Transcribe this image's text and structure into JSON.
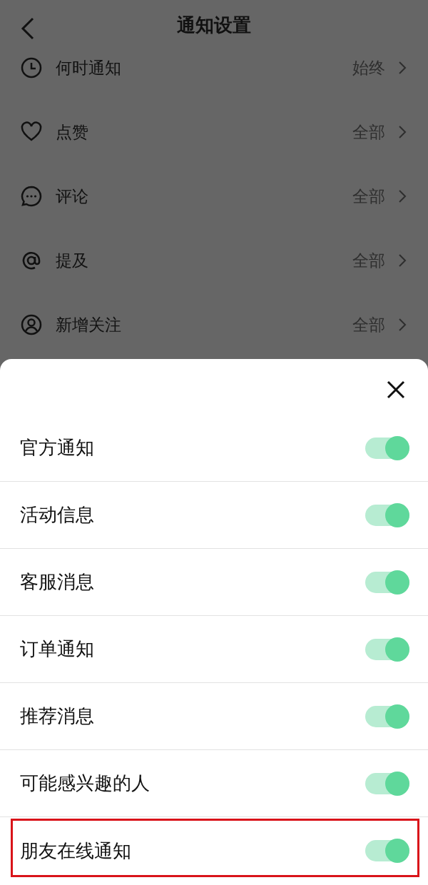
{
  "header": {
    "title": "通知设置"
  },
  "settings": [
    {
      "label": "何时通知",
      "value": "始终"
    },
    {
      "label": "点赞",
      "value": "全部"
    },
    {
      "label": "评论",
      "value": "全部"
    },
    {
      "label": "提及",
      "value": "全部"
    },
    {
      "label": "新增关注",
      "value": "全部"
    }
  ],
  "sheet": {
    "items": [
      {
        "label": "官方通知",
        "on": true,
        "highlighted": false
      },
      {
        "label": "活动信息",
        "on": true,
        "highlighted": false
      },
      {
        "label": "客服消息",
        "on": true,
        "highlighted": false
      },
      {
        "label": "订单通知",
        "on": true,
        "highlighted": false
      },
      {
        "label": "推荐消息",
        "on": true,
        "highlighted": false
      },
      {
        "label": "可能感兴趣的人",
        "on": true,
        "highlighted": false
      },
      {
        "label": "朋友在线通知",
        "on": true,
        "highlighted": true
      }
    ]
  }
}
